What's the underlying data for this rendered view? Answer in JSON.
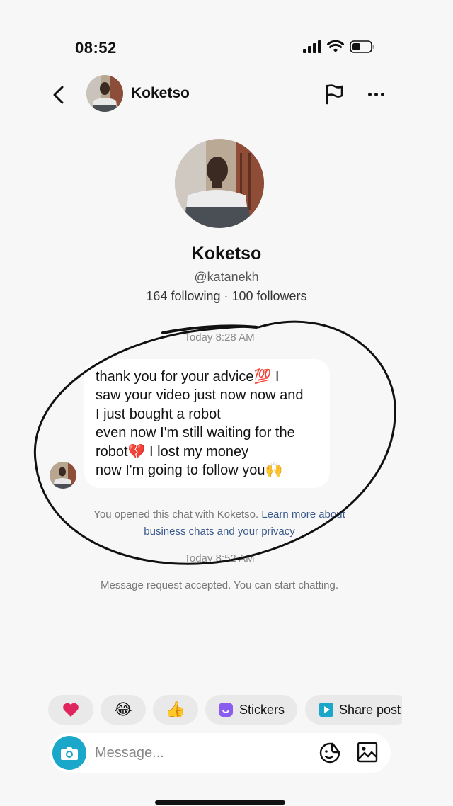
{
  "status_bar": {
    "time": "08:52",
    "icons": [
      "signal-icon",
      "wifi-icon",
      "battery-icon"
    ]
  },
  "header": {
    "title": "Koketso",
    "back_icon": "chevron-left-icon",
    "flag_icon": "flag-icon",
    "more_icon": "more-horizontal-icon"
  },
  "profile": {
    "name": "Koketso",
    "handle": "@katanekh",
    "stats": "164 following · 100 followers"
  },
  "chat": {
    "timestamp1": "Today 8:28 AM",
    "message_lines": [
      "thank you for your advice💯 I",
      "saw your video just now now and",
      "I just bought a robot",
      "even now I'm still waiting for the",
      "robot💔 I lost my money",
      "now I'm going to follow you🙌"
    ],
    "info_text": "You opened this chat with Koketso.",
    "info_link": "Learn more about business chats and your privacy",
    "timestamp2": "Today 8:52 AM",
    "accepted_text": "Message request accepted. You can start chatting."
  },
  "quick_replies": [
    {
      "emoji": "❤️",
      "label": "",
      "icon": "heart-icon"
    },
    {
      "emoji": "😂",
      "label": "",
      "icon": "laugh-emoji-icon"
    },
    {
      "emoji": "👍",
      "label": "",
      "icon": "thumbs-up-icon"
    },
    {
      "emoji": "",
      "label": "Stickers",
      "icon": "sticker-icon"
    },
    {
      "emoji": "",
      "label": "Share post",
      "icon": "share-post-icon"
    }
  ],
  "composer": {
    "placeholder": "Message...",
    "camera_icon": "camera-icon",
    "sticker_icon": "sticker-face-icon",
    "image_icon": "image-icon"
  },
  "colors": {
    "background": "#f7f7f7",
    "accent": "#1aa7c9",
    "link": "#3a5a8c",
    "bubble": "#ffffff",
    "heart": "#e0245e"
  }
}
